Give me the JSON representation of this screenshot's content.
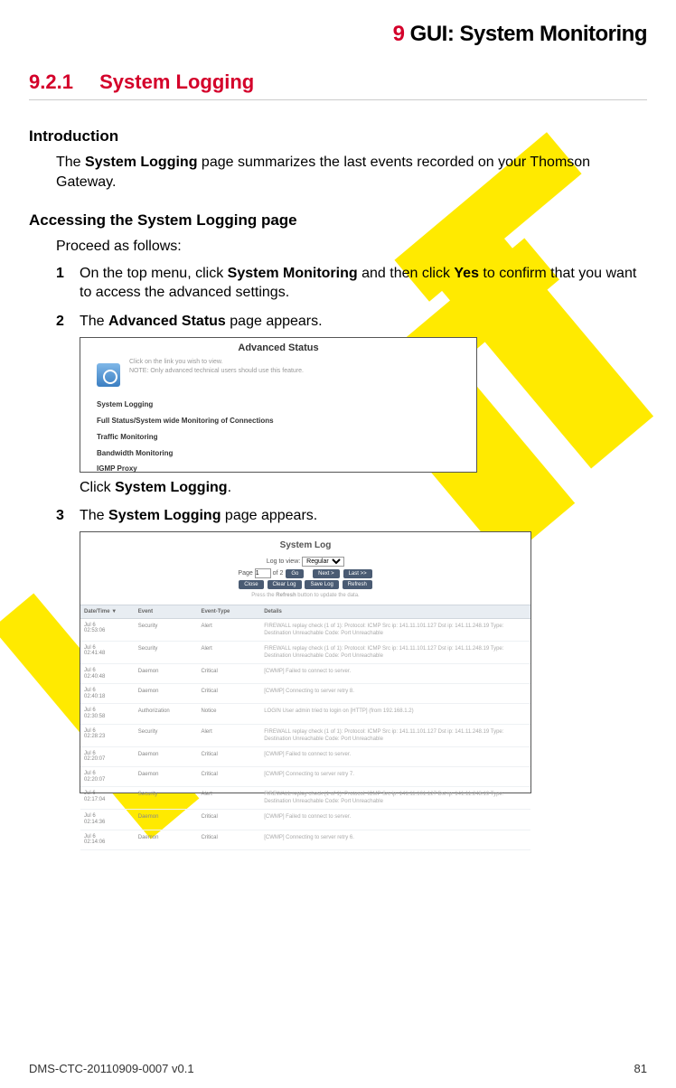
{
  "header": {
    "num": "9",
    "title": "GUI: System Monitoring"
  },
  "section": {
    "num": "9.2.1",
    "title": "System Logging"
  },
  "intro": {
    "head": "Introduction",
    "p_pre": "The ",
    "p_b": "System Logging",
    "p_post": " page summarizes the last events recorded on your Thomson Gateway."
  },
  "access": {
    "head": "Accessing the System Logging page",
    "lead": "Proceed as follows:",
    "steps": {
      "s1": {
        "num": "1",
        "pre": "On the top menu, click ",
        "b1": "System Monitoring",
        "mid": " and then click ",
        "b2": "Yes",
        "post": " to confirm that you want to access the advanced settings."
      },
      "s2": {
        "num": "2",
        "pre": "The ",
        "b": "Advanced Status",
        "post": " page appears.",
        "click_pre": "Click ",
        "click_b": "System Logging",
        "click_post": "."
      },
      "s3": {
        "num": "3",
        "pre": "The ",
        "b": "System Logging",
        "post": " page appears."
      }
    }
  },
  "shot1": {
    "title": "Advanced Status",
    "note_a": "Click on the link you wish to view.",
    "note_b": "NOTE: Only advanced technical users should use this feature.",
    "links": {
      "l1": "System Logging",
      "l2": "Full Status/System wide Monitoring of Connections",
      "l3": "Traffic Monitoring",
      "l4": "Bandwidth Monitoring",
      "l5": "IGMP Proxy"
    }
  },
  "shot2": {
    "title": "System Log",
    "log_to_view": "Log to view:",
    "log_opt": "Regular",
    "page_label_a": "Page",
    "page_val": "1",
    "page_label_b": "of 2",
    "go": "Go",
    "next": "Next >",
    "last": "Last >>",
    "btns": {
      "close": "Close",
      "clear": "Clear Log",
      "save": "Save Log",
      "refresh": "Refresh"
    },
    "hint_a": "Press the ",
    "hint_b": "Refresh",
    "hint_c": " button to update the data.",
    "cols": {
      "dt": "Date/Time ▼",
      "ev": "Event",
      "et": "Event-Type",
      "det": "Details"
    },
    "rows": [
      {
        "dt": "Jul 6\n02:53:06",
        "ev": "Security",
        "et": "Alert",
        "det": "FIREWALL replay check (1 of 1): Protocol: ICMP Src ip: 141.11.101.127 Dst ip: 141.11.248.19 Type: Destination Unreachable Code: Port Unreachable"
      },
      {
        "dt": "Jul 6\n02:41:48",
        "ev": "Security",
        "et": "Alert",
        "det": "FIREWALL replay check (1 of 1): Protocol: ICMP Src ip: 141.11.101.127 Dst ip: 141.11.248.19 Type: Destination Unreachable Code: Port Unreachable"
      },
      {
        "dt": "Jul 6\n02:40:48",
        "ev": "Daemon",
        "et": "Critical",
        "det": "[CWMP] Failed to connect to server."
      },
      {
        "dt": "Jul 6\n02:40:18",
        "ev": "Daemon",
        "et": "Critical",
        "det": "[CWMP] Connecting to server retry 8."
      },
      {
        "dt": "Jul 6\n02:30:58",
        "ev": "Authorization",
        "et": "Notice",
        "det": "LOGIN User admin tried to login on [HTTP] (from 192.168.1.2)"
      },
      {
        "dt": "Jul 6\n02:28:23",
        "ev": "Security",
        "et": "Alert",
        "det": "FIREWALL replay check (1 of 1): Protocol: ICMP Src ip: 141.11.101.127 Dst ip: 141.11.248.19 Type: Destination Unreachable Code: Port Unreachable"
      },
      {
        "dt": "Jul 6\n02:20:07",
        "ev": "Daemon",
        "et": "Critical",
        "det": "[CWMP] Failed to connect to server."
      },
      {
        "dt": "Jul 6\n02:20:07",
        "ev": "Daemon",
        "et": "Critical",
        "det": "[CWMP] Connecting to server retry 7."
      },
      {
        "dt": "Jul 6\n02:17:04",
        "ev": "Security",
        "et": "Alert",
        "det": "FIREWALL replay check (1 of 1): Protocol: ICMP Src ip: 141.11.101.127 Dst ip: 141.11.248.19 Type: Destination Unreachable Code: Port Unreachable"
      },
      {
        "dt": "Jul 6\n02:14:36",
        "ev": "Daemon",
        "et": "Critical",
        "det": "[CWMP] Failed to connect to server."
      },
      {
        "dt": "Jul 6\n02:14:06",
        "ev": "Daemon",
        "et": "Critical",
        "det": "[CWMP] Connecting to server retry 6."
      }
    ]
  },
  "footer": {
    "doc": "DMS-CTC-20110909-0007 v0.1",
    "page": "81"
  }
}
